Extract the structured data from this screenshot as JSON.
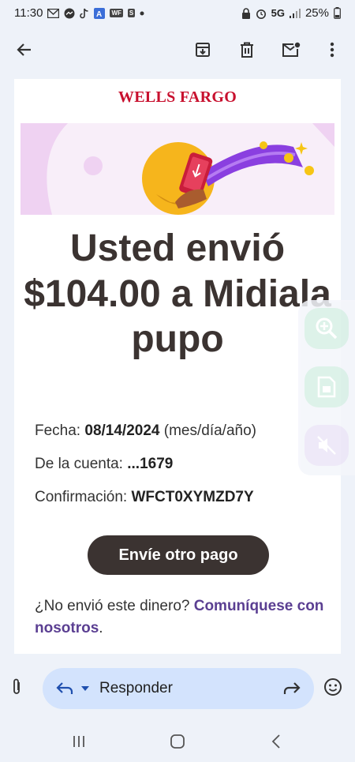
{
  "status_bar": {
    "time": "11:30",
    "network": "5G",
    "battery": "25%",
    "notification_icons": [
      "gmail-icon",
      "messenger-icon",
      "tiktok-icon",
      "translate-icon",
      "wellsfargo-icon",
      "s-icon"
    ]
  },
  "email": {
    "brand": "WELLS FARGO",
    "headline": "Usted envió $104.00 a Midiala pupo",
    "details": [
      {
        "label": "Fecha:",
        "value": "08/14/2024",
        "suffix": "(mes/día/año)"
      },
      {
        "label": "De la cuenta:",
        "value": "...1679",
        "suffix": ""
      },
      {
        "label": "Confirmación:",
        "value": "WFCT0XYMZD7Y",
        "suffix": ""
      }
    ],
    "cta_label": "Envíe otro pago",
    "footer_text": "¿No envió este dinero?",
    "footer_link": "Comuníquese con nosotros",
    "footer_end": "."
  },
  "reply_bar": {
    "reply_label": "Responder"
  },
  "colors": {
    "brand_red": "#c8102e",
    "headline": "#3b3331",
    "cta_bg": "#3b3331",
    "link": "#5b3f92",
    "reply_pill": "#d3e3fd"
  }
}
